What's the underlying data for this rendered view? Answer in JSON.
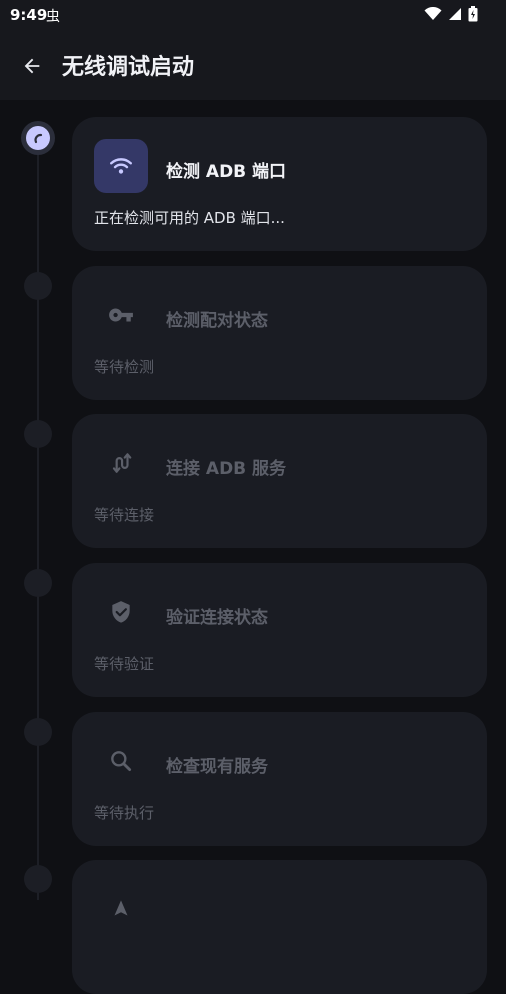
{
  "status_bar": {
    "time": "9:49",
    "debug_glyph": "虫",
    "icons": [
      "wifi-icon",
      "signal-icon",
      "battery-icon"
    ]
  },
  "app_bar": {
    "title": "无线调试启动",
    "back_icon": "arrow-back-icon"
  },
  "steps": [
    {
      "title": "检测 ADB 端口",
      "subtitle": "正在检测可用的 ADB 端口...",
      "icon": "wifi-icon",
      "state": "active"
    },
    {
      "title": "检测配对状态",
      "subtitle": "等待检测",
      "icon": "key-icon",
      "state": "pending"
    },
    {
      "title": "连接 ADB 服务",
      "subtitle": "等待连接",
      "icon": "swap-icon",
      "state": "pending"
    },
    {
      "title": "验证连接状态",
      "subtitle": "等待验证",
      "icon": "shield-check-icon",
      "state": "pending"
    },
    {
      "title": "检查现有服务",
      "subtitle": "等待执行",
      "icon": "search-icon",
      "state": "pending"
    }
  ],
  "colors": {
    "background": "#0f1014",
    "card": "#1a1c23",
    "accent": "#c8c9ff",
    "icon_box_active": "#343867",
    "text_disabled": "#5c5f69"
  }
}
